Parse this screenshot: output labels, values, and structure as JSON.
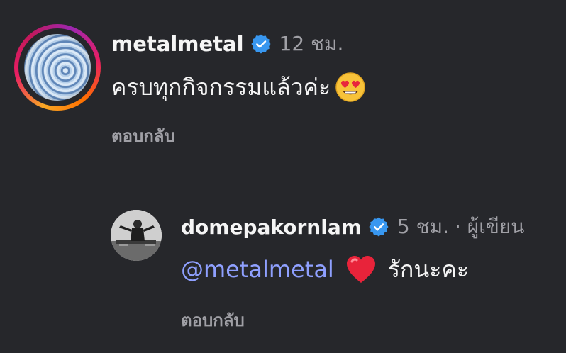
{
  "comment1": {
    "username": "metalmetal",
    "time": "12 ชม.",
    "text": "ครบทุกกิจกรรมแล้วค่ะ",
    "emoji": "smiling-face-with-heart-eyes",
    "reply_label": "ตอบกลับ"
  },
  "comment2": {
    "username": "domepakornlam",
    "time": "5 ชม.",
    "author_tag": "· ผู้เขียน",
    "mention": "@metalmetal",
    "emoji": "red-heart",
    "text": "รักนะคะ",
    "reply_label": "ตอบกลับ"
  },
  "colors": {
    "background": "#26272b",
    "verified": "#3897f0",
    "mention": "#8fa0ff",
    "secondary_text": "#a0a0a6"
  }
}
